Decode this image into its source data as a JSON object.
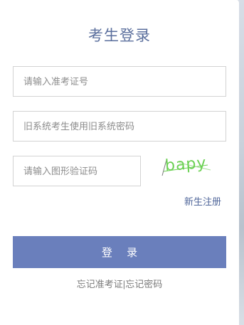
{
  "title": "考生登录",
  "fields": {
    "exam_id": {
      "value": "",
      "placeholder": "请输入准考证号"
    },
    "password": {
      "value": "",
      "placeholder": "旧系统考生使用旧系统密码"
    },
    "captcha": {
      "value": "",
      "placeholder": "请输入图形验证码"
    }
  },
  "captcha_image": {
    "text": "bapy"
  },
  "register_link": "新生注册",
  "login_button": "登 录",
  "forgot": {
    "exam_id": "忘记准考证",
    "separator": "|",
    "password": "忘记密码"
  },
  "colors": {
    "title": "#5b6f9d",
    "button": "#6a7fbc",
    "link": "#50669a",
    "captcha": "#6cd154"
  }
}
